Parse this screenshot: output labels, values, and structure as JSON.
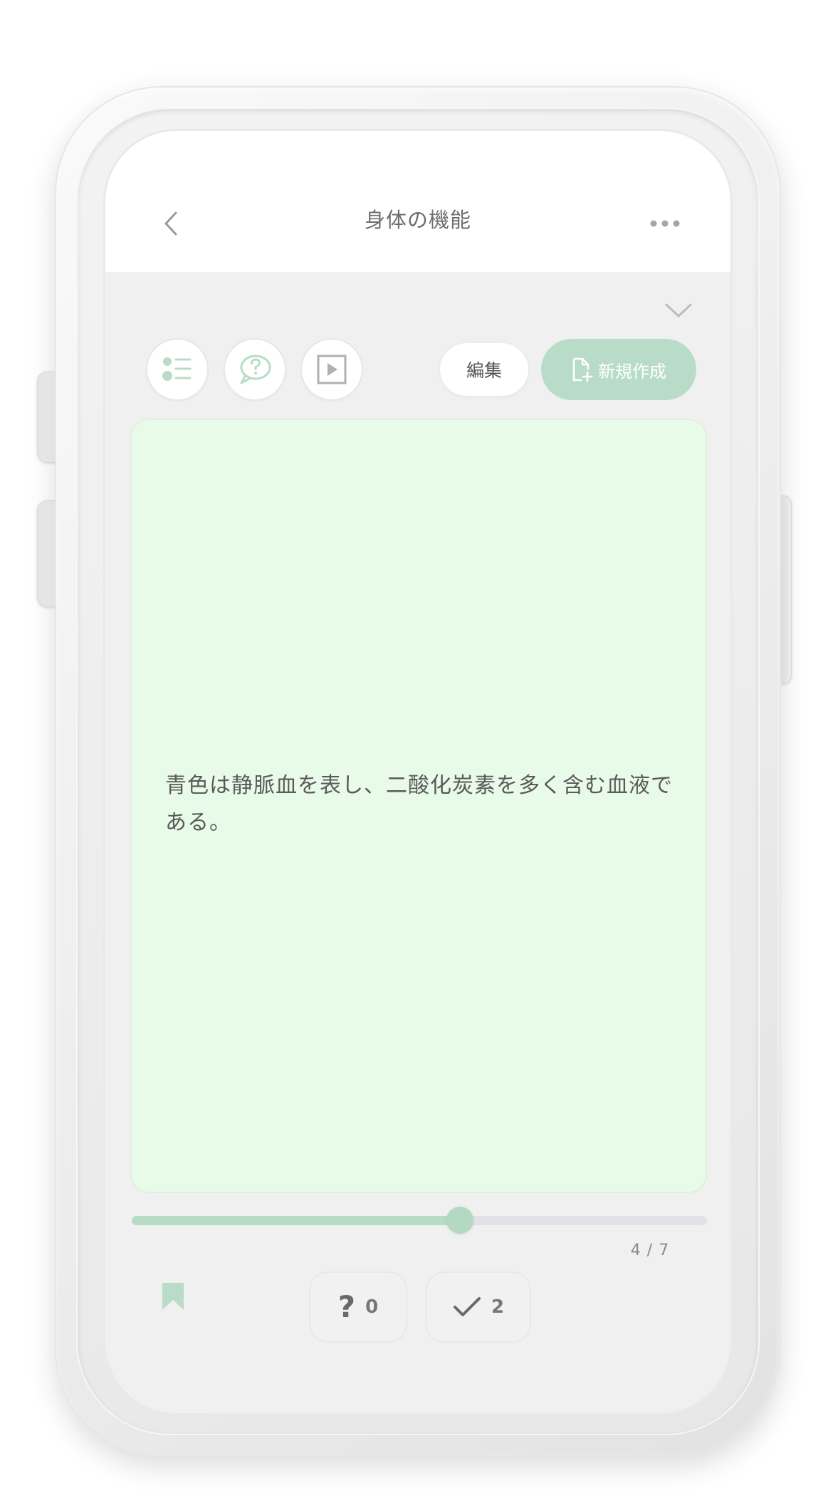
{
  "header": {
    "title": "身体の機能",
    "back_icon": "chevron-left-icon",
    "more_icon": "ellipsis-icon"
  },
  "toolbar": {
    "collapse_icon": "chevron-down-icon",
    "list_icon": "list-icon",
    "hint_icon": "question-bubble-icon",
    "play_icon": "play-icon",
    "edit_label": "編集",
    "new_label": "新規作成",
    "new_icon": "new-document-icon"
  },
  "card": {
    "text": "青色は静脈血を表し、二酸化炭素を多く含む血液である。"
  },
  "progress": {
    "current": 4,
    "total": 7,
    "label": "4 / 7",
    "fraction": 0.57
  },
  "footer": {
    "bookmark_icon": "bookmark-icon",
    "unknown_glyph": "?",
    "unknown_count": "0",
    "known_icon": "checkmark-icon",
    "known_count": "2"
  },
  "colors": {
    "accent": "#b9dcc8",
    "card_background": "#e8fae8",
    "screen_background": "#f0f0f0",
    "nav_background": "#ffffff",
    "text": "#5a5a5a"
  }
}
